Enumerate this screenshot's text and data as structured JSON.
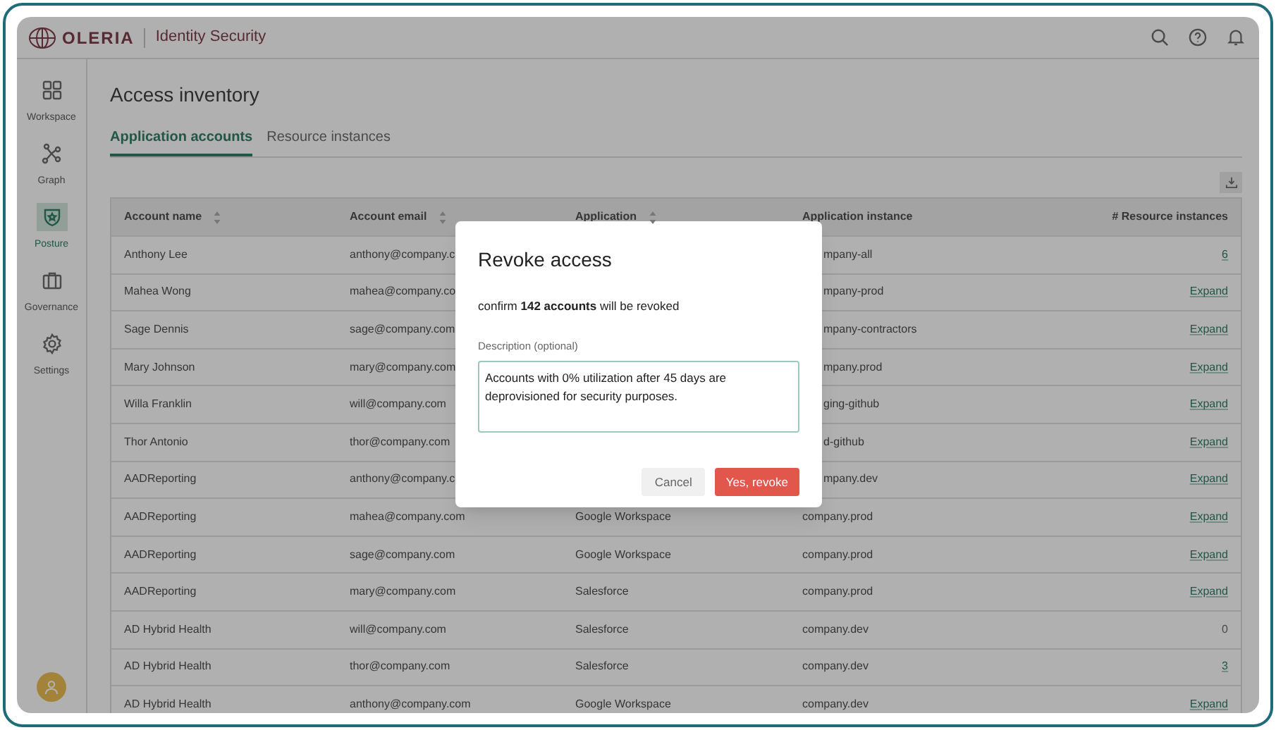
{
  "brand": {
    "logo_text": "OLERIA",
    "product": "Identity Security"
  },
  "sidebar": {
    "items": [
      {
        "label": "Workspace",
        "selected": false
      },
      {
        "label": "Graph",
        "selected": false
      },
      {
        "label": "Posture",
        "selected": true
      },
      {
        "label": "Governance",
        "selected": false
      },
      {
        "label": "Settings",
        "selected": false
      }
    ]
  },
  "page": {
    "title": "Access inventory"
  },
  "tabs": [
    {
      "label": "Application accounts",
      "selected": true
    },
    {
      "label": "Resource instances",
      "selected": false
    }
  ],
  "table": {
    "columns": [
      {
        "label": "Account name",
        "sortable": true
      },
      {
        "label": "Account email",
        "sortable": true
      },
      {
        "label": "Application",
        "sortable": true
      },
      {
        "label": "Application instance",
        "sortable": false
      },
      {
        "label": "# Resource instances",
        "sortable": false
      }
    ],
    "rows": [
      {
        "name": "Anthony Lee",
        "email": "anthony@company.c",
        "instance": "mpany-all",
        "resources": "6",
        "kind": "link"
      },
      {
        "name": "Mahea Wong",
        "email": "mahea@company.co",
        "instance": "mpany-prod",
        "resources": "Expand",
        "kind": "link"
      },
      {
        "name": "Sage Dennis",
        "email": "sage@company.com",
        "instance": "mpany-contractors",
        "resources": "Expand",
        "kind": "link"
      },
      {
        "name": "Mary Johnson",
        "email": "mary@company.com",
        "instance": "mpany.prod",
        "resources": "Expand",
        "kind": "link"
      },
      {
        "name": "Willa Franklin",
        "email": "will@company.com",
        "instance": "ging-github",
        "resources": "Expand",
        "kind": "link"
      },
      {
        "name": "Thor Antonio",
        "email": "thor@company.com",
        "instance": "d-github",
        "resources": "Expand",
        "kind": "link"
      },
      {
        "name": "AADReporting",
        "email": "anthony@company.c",
        "instance": "mpany.dev",
        "resources": "Expand",
        "kind": "link"
      },
      {
        "name": "AADReporting",
        "email": "mahea@company.com",
        "application": "Google Workspace",
        "instance": "company.prod",
        "resources": "Expand",
        "kind": "link"
      },
      {
        "name": "AADReporting",
        "email": "sage@company.com",
        "application": "Google Workspace",
        "instance": "company.prod",
        "resources": "Expand",
        "kind": "link"
      },
      {
        "name": "AADReporting",
        "email": "mary@company.com",
        "application": "Salesforce",
        "instance": "company.prod",
        "resources": "Expand",
        "kind": "link"
      },
      {
        "name": "AD Hybrid Health",
        "email": "will@company.com",
        "application": "Salesforce",
        "instance": "company.dev",
        "resources": "0",
        "kind": "text"
      },
      {
        "name": "AD Hybrid Health",
        "email": "thor@company.com",
        "application": "Salesforce",
        "instance": "company.dev",
        "resources": "3",
        "kind": "link"
      },
      {
        "name": "AD Hybrid Health",
        "email": "anthony@company.com",
        "application": "Google Workspace",
        "instance": "company.dev",
        "resources": "Expand",
        "kind": "link"
      }
    ]
  },
  "dialog": {
    "title": "Revoke access",
    "message": "confirm **142 accounts** will be revoked",
    "field_label": "Description (optional)",
    "field_value": "Accounts with 0% utilization after 45 days are deprovisioned for security purposes.",
    "cancel": "Cancel",
    "confirm": "Yes, revoke"
  }
}
